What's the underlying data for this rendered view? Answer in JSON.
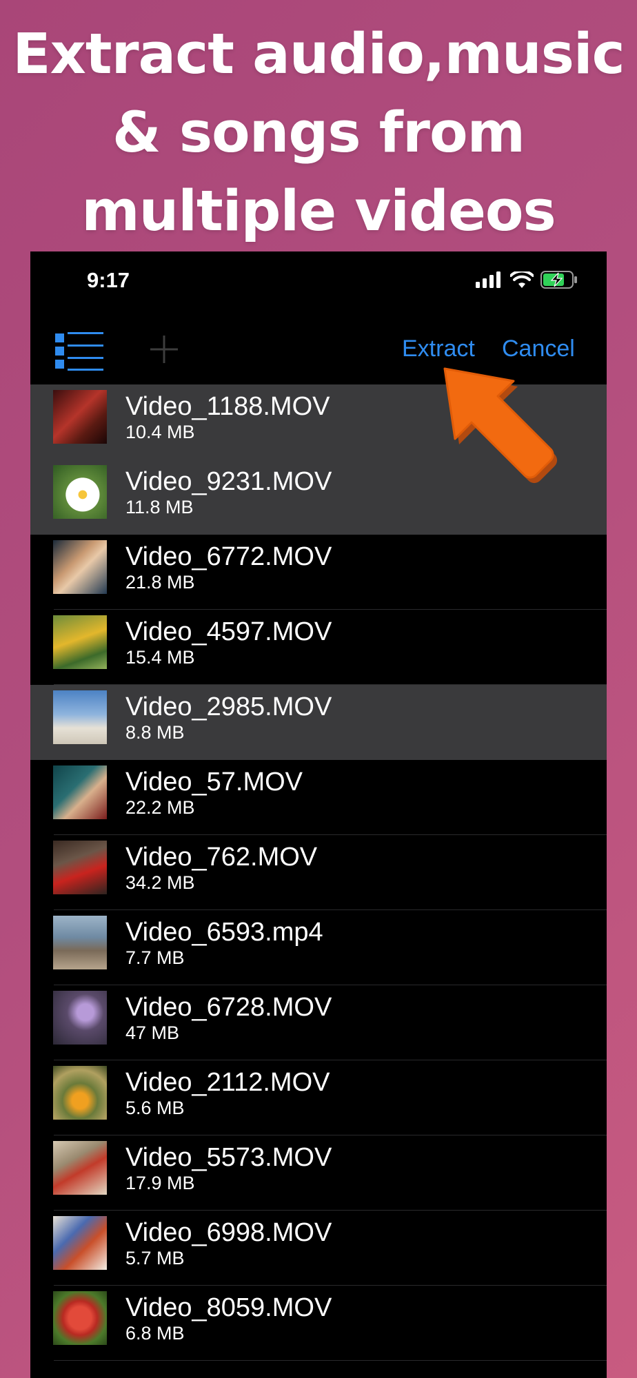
{
  "headline": {
    "line1": "Extract audio,music",
    "line2": "& songs from",
    "line3": "multiple videos"
  },
  "status_bar": {
    "time": "9:17",
    "icons": [
      "cellular-signal-icon",
      "wifi-icon",
      "battery-charging-icon"
    ]
  },
  "toolbar": {
    "list_icon": "list-icon",
    "add_icon": "plus-icon",
    "extract_label": "Extract",
    "cancel_label": "Cancel",
    "accent_color": "#2f8cf0"
  },
  "videos": [
    {
      "name": "Video_1188.MOV",
      "size": "10.4 MB",
      "selected": true
    },
    {
      "name": "Video_9231.MOV",
      "size": "11.8 MB",
      "selected": true
    },
    {
      "name": "Video_6772.MOV",
      "size": "21.8 MB",
      "selected": false
    },
    {
      "name": "Video_4597.MOV",
      "size": "15.4 MB",
      "selected": false
    },
    {
      "name": "Video_2985.MOV",
      "size": "8.8 MB",
      "selected": true
    },
    {
      "name": "Video_57.MOV",
      "size": "22.2 MB",
      "selected": false
    },
    {
      "name": "Video_762.MOV",
      "size": "34.2 MB",
      "selected": false
    },
    {
      "name": "Video_6593.mp4",
      "size": "7.7 MB",
      "selected": false
    },
    {
      "name": "Video_6728.MOV",
      "size": "47 MB",
      "selected": false
    },
    {
      "name": "Video_2112.MOV",
      "size": "5.6 MB",
      "selected": false
    },
    {
      "name": "Video_5573.MOV",
      "size": "17.9 MB",
      "selected": false
    },
    {
      "name": "Video_6998.MOV",
      "size": "5.7 MB",
      "selected": false
    },
    {
      "name": "Video_8059.MOV",
      "size": "6.8 MB",
      "selected": false
    }
  ],
  "colors": {
    "selected_row": "#3a3a3c",
    "arrow": "#f26a10"
  }
}
